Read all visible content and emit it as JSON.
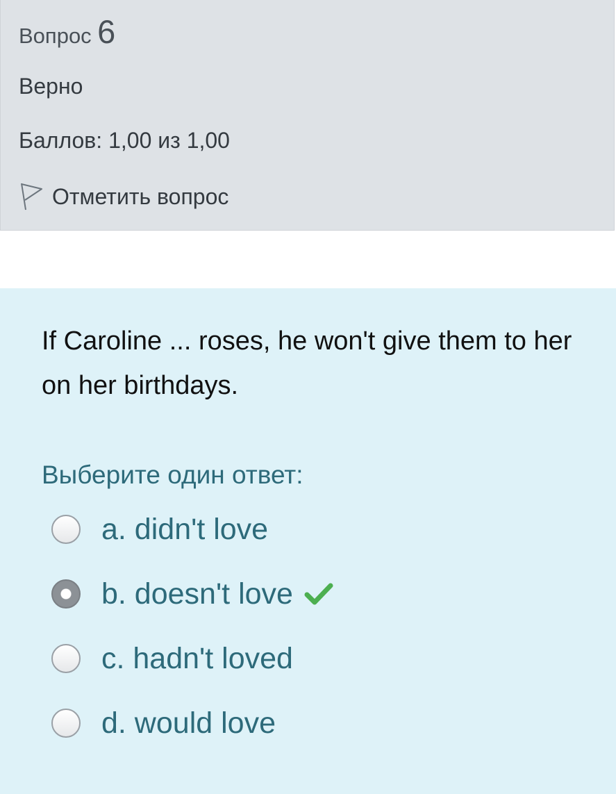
{
  "info": {
    "question_label": "Вопрос",
    "question_number": "6",
    "state": "Верно",
    "grade": "Баллов: 1,00 из 1,00",
    "flag_label": "Отметить вопрос"
  },
  "question": {
    "text": "If Caroline ...  roses, he won't give them to her on her birthdays.",
    "prompt": "Выберите один ответ:",
    "answers": [
      {
        "label": "a. didn't love",
        "selected": false
      },
      {
        "label": "b. doesn't love",
        "selected": true,
        "correct": true
      },
      {
        "label": "c. hadn't loved",
        "selected": false
      },
      {
        "label": "d. would love",
        "selected": false
      }
    ]
  },
  "colors": {
    "info_bg": "#dee2e6",
    "content_bg": "#def2f8",
    "answer_text": "#2d6a7a",
    "correct_tick": "#4caf50"
  },
  "icons": {
    "flag": "flag-icon",
    "correct": "check-icon"
  }
}
